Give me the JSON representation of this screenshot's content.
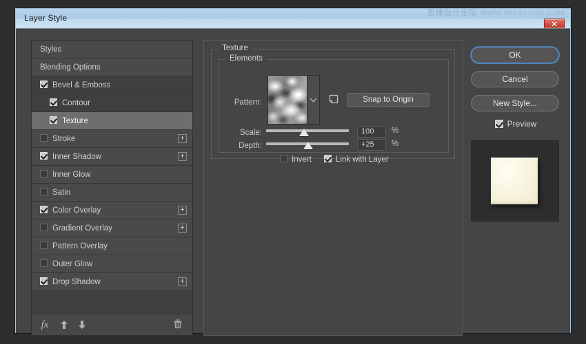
{
  "window": {
    "title": "Layer Style",
    "close_label": "✕",
    "watermark_cn": "思缘设计论坛",
    "watermark_en": "WWW.MISSYUAN.COM"
  },
  "sidebar": {
    "items": [
      {
        "label": "Styles",
        "type": "plain",
        "checkbox": "none",
        "plus": false
      },
      {
        "label": "Blending Options",
        "type": "plain",
        "checkbox": "none",
        "plus": false
      },
      {
        "label": "Bevel & Emboss",
        "type": "group",
        "checkbox": "checked",
        "plus": false
      },
      {
        "label": "Contour",
        "type": "child",
        "checkbox": "checked",
        "plus": false
      },
      {
        "label": "Texture",
        "type": "child",
        "checkbox": "checked",
        "plus": false,
        "selected": true
      },
      {
        "label": "Stroke",
        "type": "plain",
        "checkbox": "unchecked",
        "plus": true
      },
      {
        "label": "Inner Shadow",
        "type": "plain",
        "checkbox": "checked",
        "plus": true
      },
      {
        "label": "Inner Glow",
        "type": "plain",
        "checkbox": "unchecked",
        "plus": false
      },
      {
        "label": "Satin",
        "type": "plain",
        "checkbox": "unchecked",
        "plus": false
      },
      {
        "label": "Color Overlay",
        "type": "plain",
        "checkbox": "checked",
        "plus": true
      },
      {
        "label": "Gradient Overlay",
        "type": "plain",
        "checkbox": "unchecked",
        "plus": true
      },
      {
        "label": "Pattern Overlay",
        "type": "plain",
        "checkbox": "unchecked",
        "plus": false
      },
      {
        "label": "Outer Glow",
        "type": "plain",
        "checkbox": "unchecked",
        "plus": false
      },
      {
        "label": "Drop Shadow",
        "type": "plain",
        "checkbox": "checked",
        "plus": true
      }
    ],
    "footer": {
      "fx_label": "fx",
      "move_up_icon": "arrow-up-icon",
      "move_down_icon": "arrow-down-icon",
      "delete_icon": "trash-icon"
    },
    "plus_label": "+"
  },
  "panel": {
    "group_title": "Texture",
    "subgroup_title": "Elements",
    "pattern_label": "Pattern:",
    "scale_label": "Scale:",
    "depth_label": "Depth:",
    "snap_button": "Snap to Origin",
    "scale_value": "100",
    "depth_value": "+25",
    "scale_percent": "%",
    "depth_percent": "%",
    "scale_slider_pct": 46,
    "depth_slider_pct": 51,
    "invert_label": "Invert",
    "invert_checked": false,
    "link_label": "Link with Layer",
    "link_checked": true
  },
  "actions": {
    "ok": "OK",
    "cancel": "Cancel",
    "new_style": "New Style...",
    "preview": "Preview",
    "preview_checked": true
  },
  "colors": {
    "dialog_bg": "#454545",
    "sidebar_bg": "#3f3f3f",
    "row_bg": "#4a4a4a",
    "selected_row": "#6e6e6e",
    "titlebar_from": "#b7d3ea",
    "titlebar_to": "#cfe3f4",
    "accent_focus": "#5b8fc9",
    "close_red": "#d3483c",
    "preview_swatch": "#f7f3dd"
  }
}
